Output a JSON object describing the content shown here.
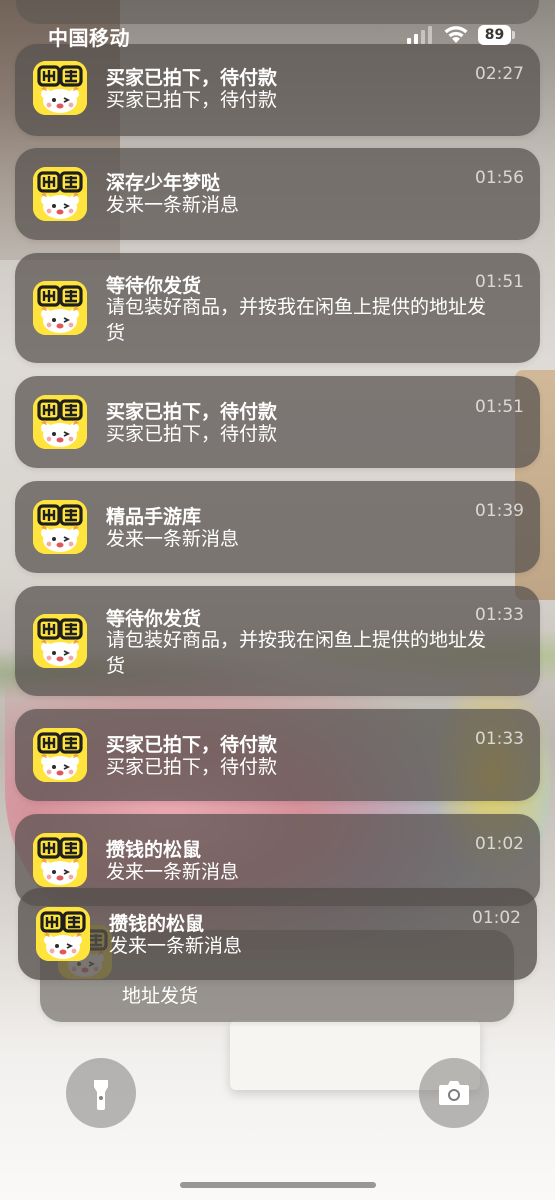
{
  "status_bar": {
    "carrier": "中国移动",
    "battery": "89",
    "icons": [
      "signal-icon",
      "wifi-icon",
      "battery-icon"
    ]
  },
  "app": {
    "icon_text": "闲鱼",
    "icon_name": "xianyu-app-icon",
    "icon_color": "#ffe43d"
  },
  "notifications": [
    {
      "title": "买家已拍下，待付款",
      "body": "买家已拍下，待付款",
      "time": "02:27"
    },
    {
      "title": "深存少年梦哒",
      "body": "发来一条新消息",
      "time": "01:56"
    },
    {
      "title": "等待你发货",
      "body": "请包装好商品，并按我在闲鱼上提供的地址发货",
      "time": "01:51"
    },
    {
      "title": "买家已拍下，待付款",
      "body": "买家已拍下，待付款",
      "time": "01:51"
    },
    {
      "title": "精品手游库",
      "body": "发来一条新消息",
      "time": "01:39"
    },
    {
      "title": "等待你发货",
      "body": "请包装好商品，并按我在闲鱼上提供的地址发货",
      "time": "01:33"
    },
    {
      "title": "买家已拍下，待付款",
      "body": "买家已拍下，待付款",
      "time": "01:33"
    },
    {
      "title": "攒钱的松鼠",
      "body": "发来一条新消息",
      "time": "01:02"
    },
    {
      "title": "攒钱的松鼠",
      "body": "发来一条新消息",
      "time": "01:02"
    }
  ],
  "stacked_notification": {
    "body": "地址发货"
  },
  "lock_controls": {
    "flashlight_icon": "flashlight-icon",
    "camera_icon": "camera-icon"
  }
}
